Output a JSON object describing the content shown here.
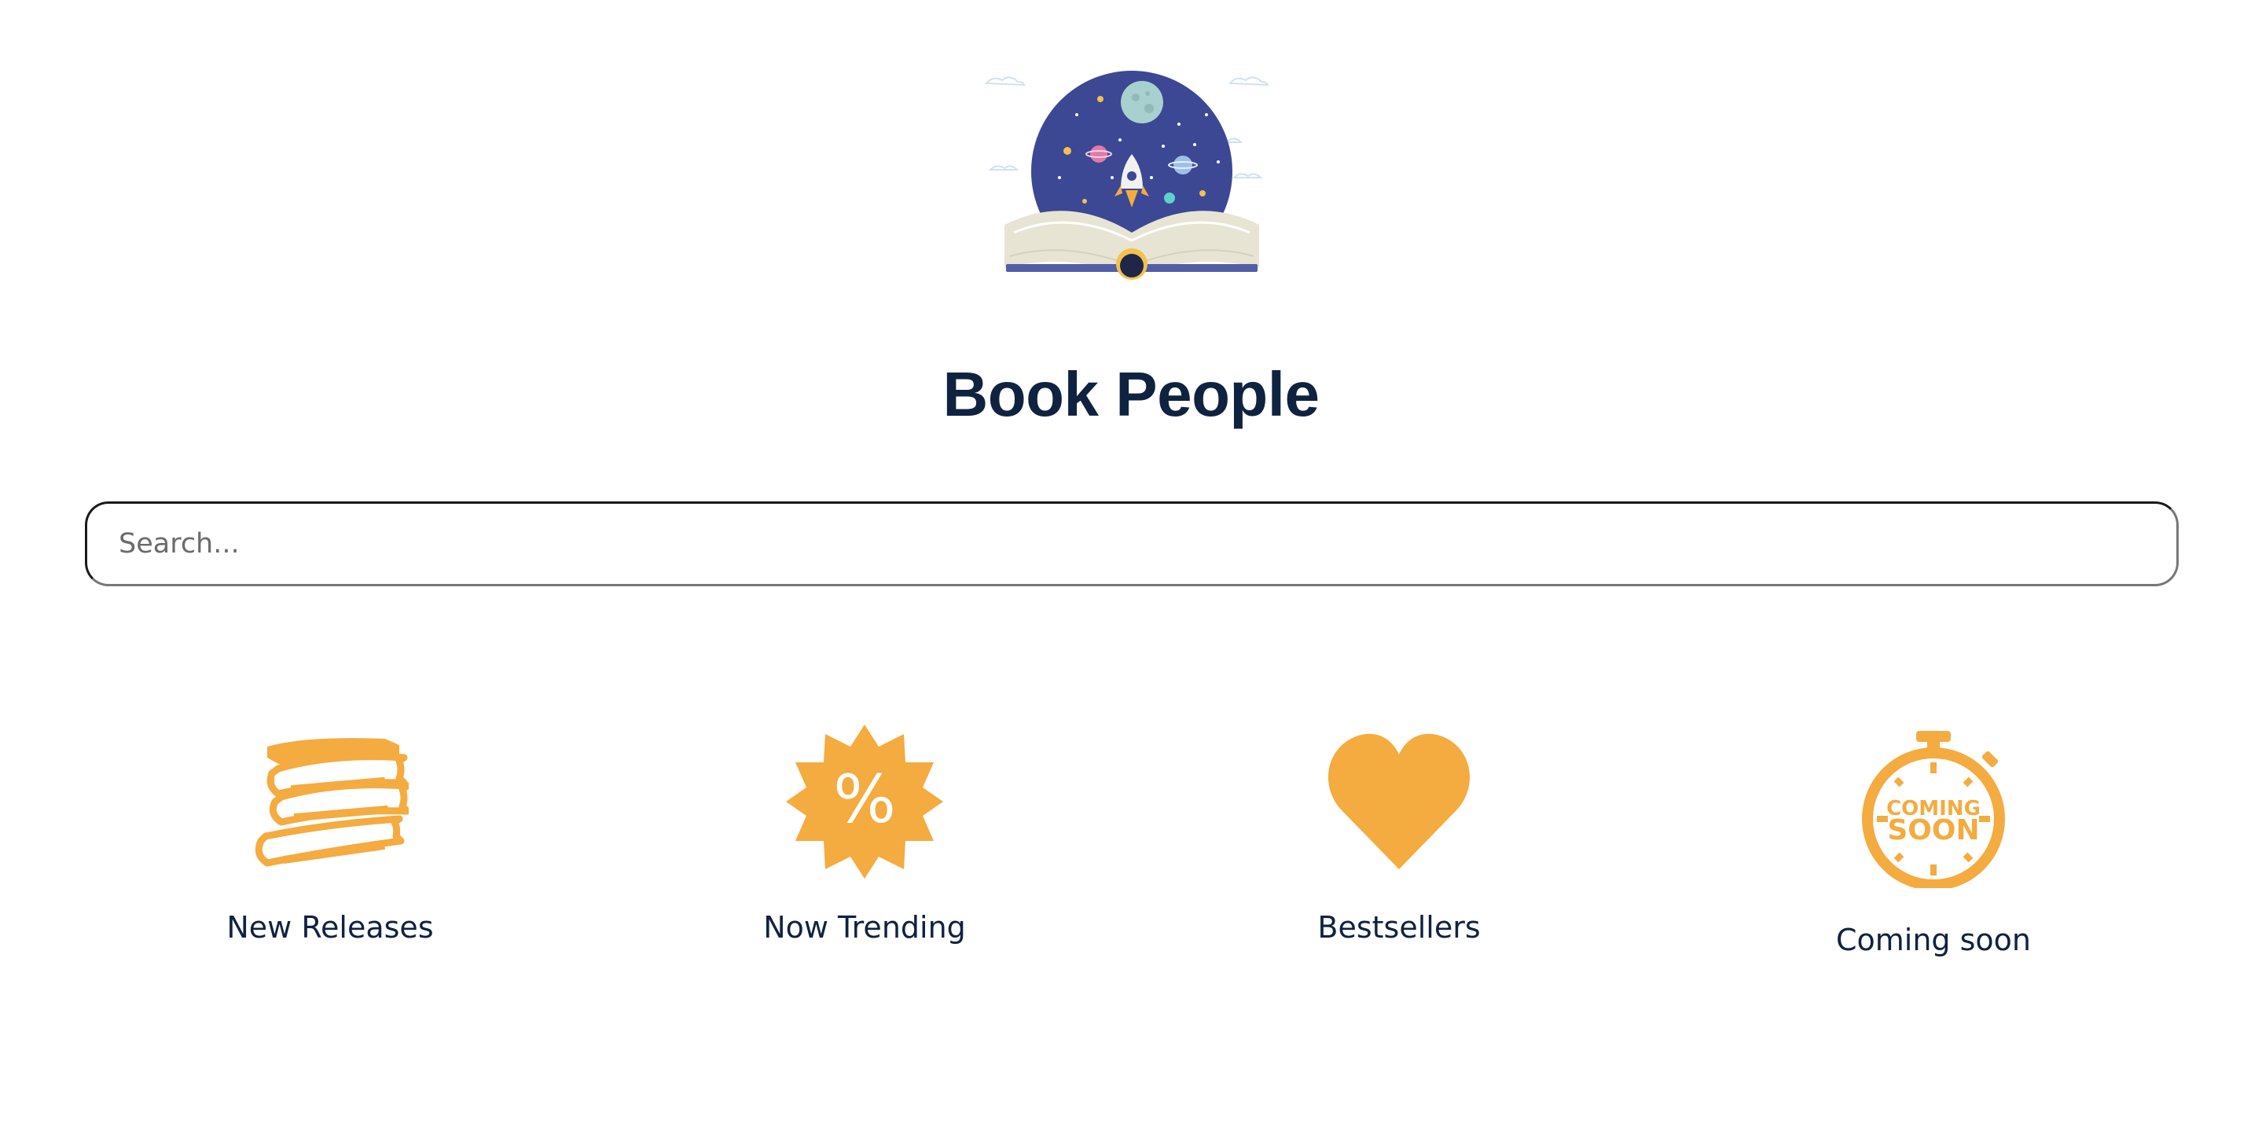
{
  "header": {
    "title": "Book People"
  },
  "search": {
    "placeholder": "Search...",
    "value": ""
  },
  "categories": [
    {
      "label": "New Releases",
      "icon": "books-stack-icon"
    },
    {
      "label": "Now Trending",
      "icon": "percent-badge-icon"
    },
    {
      "label": "Bestsellers",
      "icon": "heart-icon"
    },
    {
      "label": "Coming soon",
      "icon": "stopwatch-coming-soon-icon",
      "icon_text_line1": "COMING",
      "icon_text_line2": "SOON"
    }
  ],
  "colors": {
    "accent": "#f4ab3f",
    "title": "#0f2340",
    "logo_sky": "#3c4893",
    "logo_book": "#e8e4d4"
  }
}
